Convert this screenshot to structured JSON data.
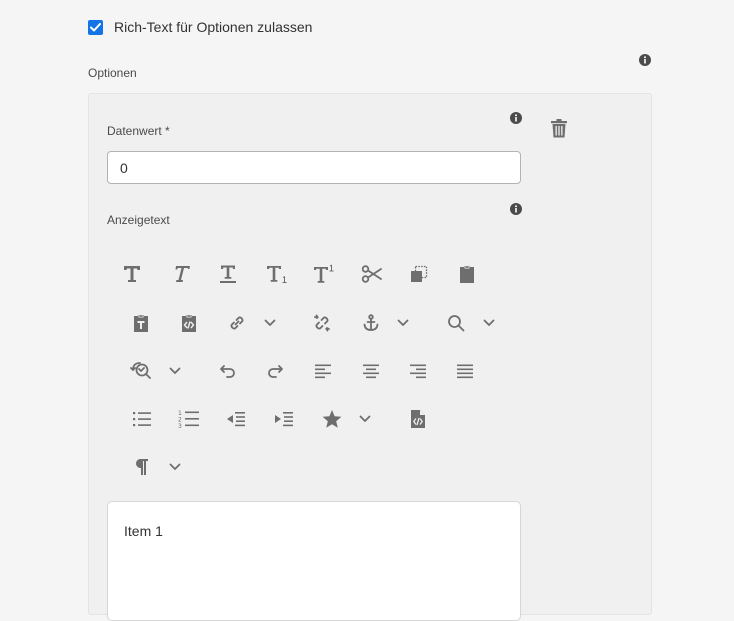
{
  "richtext": {
    "label": "Rich-Text für Optionen zulassen",
    "checked": true
  },
  "options": {
    "label": "Optionen"
  },
  "option_item": {
    "value_label": "Datenwert *",
    "value": "0",
    "display_label": "Anzeigetext",
    "editor_text": "Item 1"
  },
  "toolbar_icons": [
    "bold-icon",
    "italic-icon",
    "underline-icon",
    "subscript-icon",
    "superscript-icon",
    "cut-icon",
    "copy-icon",
    "paste-icon",
    "paste-text-icon",
    "paste-html-icon",
    "link-icon",
    "unlink-icon",
    "anchor-icon",
    "find-icon",
    "find-replace-icon",
    "undo-icon",
    "redo-icon",
    "align-left-icon",
    "align-center-icon",
    "align-right-icon",
    "justify-icon",
    "bullet-list-icon",
    "numbered-list-icon",
    "outdent-icon",
    "indent-icon",
    "special-char-icon",
    "source-edit-icon",
    "paragraph-format-icon"
  ],
  "colors": {
    "accent": "#1473e6",
    "icon": "#6e6e6e",
    "panel": "#f0f0f0"
  }
}
